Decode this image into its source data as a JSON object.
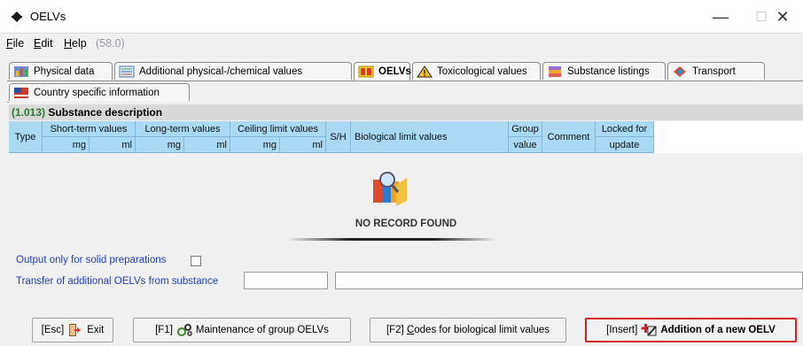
{
  "window": {
    "title": "OELVs",
    "min_glyph": "—",
    "max_glyph": "☐",
    "close_glyph": "✕"
  },
  "menu": {
    "file": "File",
    "edit": "Edit",
    "help": "Help",
    "version": "(58.0)"
  },
  "tabs_row1": [
    {
      "label": "Physical data",
      "icon": "physical-data-icon",
      "active": false
    },
    {
      "label": "Additional physical-/chemical values",
      "icon": "chemical-values-icon",
      "active": false
    },
    {
      "label": "OELVs",
      "icon": "oelv-icon",
      "active": true
    },
    {
      "label": "Toxicological values",
      "icon": "hazard-icon",
      "active": false
    },
    {
      "label": "Substance listings",
      "icon": "listings-icon",
      "active": false
    },
    {
      "label": "Transport",
      "icon": "transport-icon",
      "active": false
    }
  ],
  "tabs_row2": [
    {
      "label": "Country specific information",
      "icon": "flag-icon",
      "active": false
    }
  ],
  "section": {
    "code": "(1.013)",
    "title": "Substance description"
  },
  "grid": {
    "type": "Type",
    "short_term": "Short-term values",
    "long_term": "Long-term values",
    "ceiling": "Ceiling limit values",
    "unit_mg": "mg",
    "unit_ml": "ml",
    "sh": "S/H",
    "bio": "Biological limit values",
    "group_line1": "Group",
    "group_line2": "value",
    "comment": "Comment",
    "locked_line1": "Locked for",
    "locked_line2": "update"
  },
  "empty_message": "NO RECORD FOUND",
  "options": {
    "solid_label": "Output only for solid preparations",
    "solid_checked": false,
    "transfer_label": "Transfer of additional OELVs from substance",
    "transfer_value": "",
    "transfer_name": ""
  },
  "buttons": {
    "exit_key": "[Esc]",
    "exit": "Exit",
    "maint_key": "[F1]",
    "maint": "Maintenance of group OELVs",
    "codes_key": "[F2]",
    "codes_c": "C",
    "codes_rest": "odes for biological limit values",
    "add_key": "[Insert]",
    "add": "Addition of a new OELV"
  },
  "colors": {
    "grid_header": "#a9d9f5",
    "section_code": "#2a7a2a",
    "link_blue": "#1f3fbf",
    "highlight": "#d42020"
  }
}
